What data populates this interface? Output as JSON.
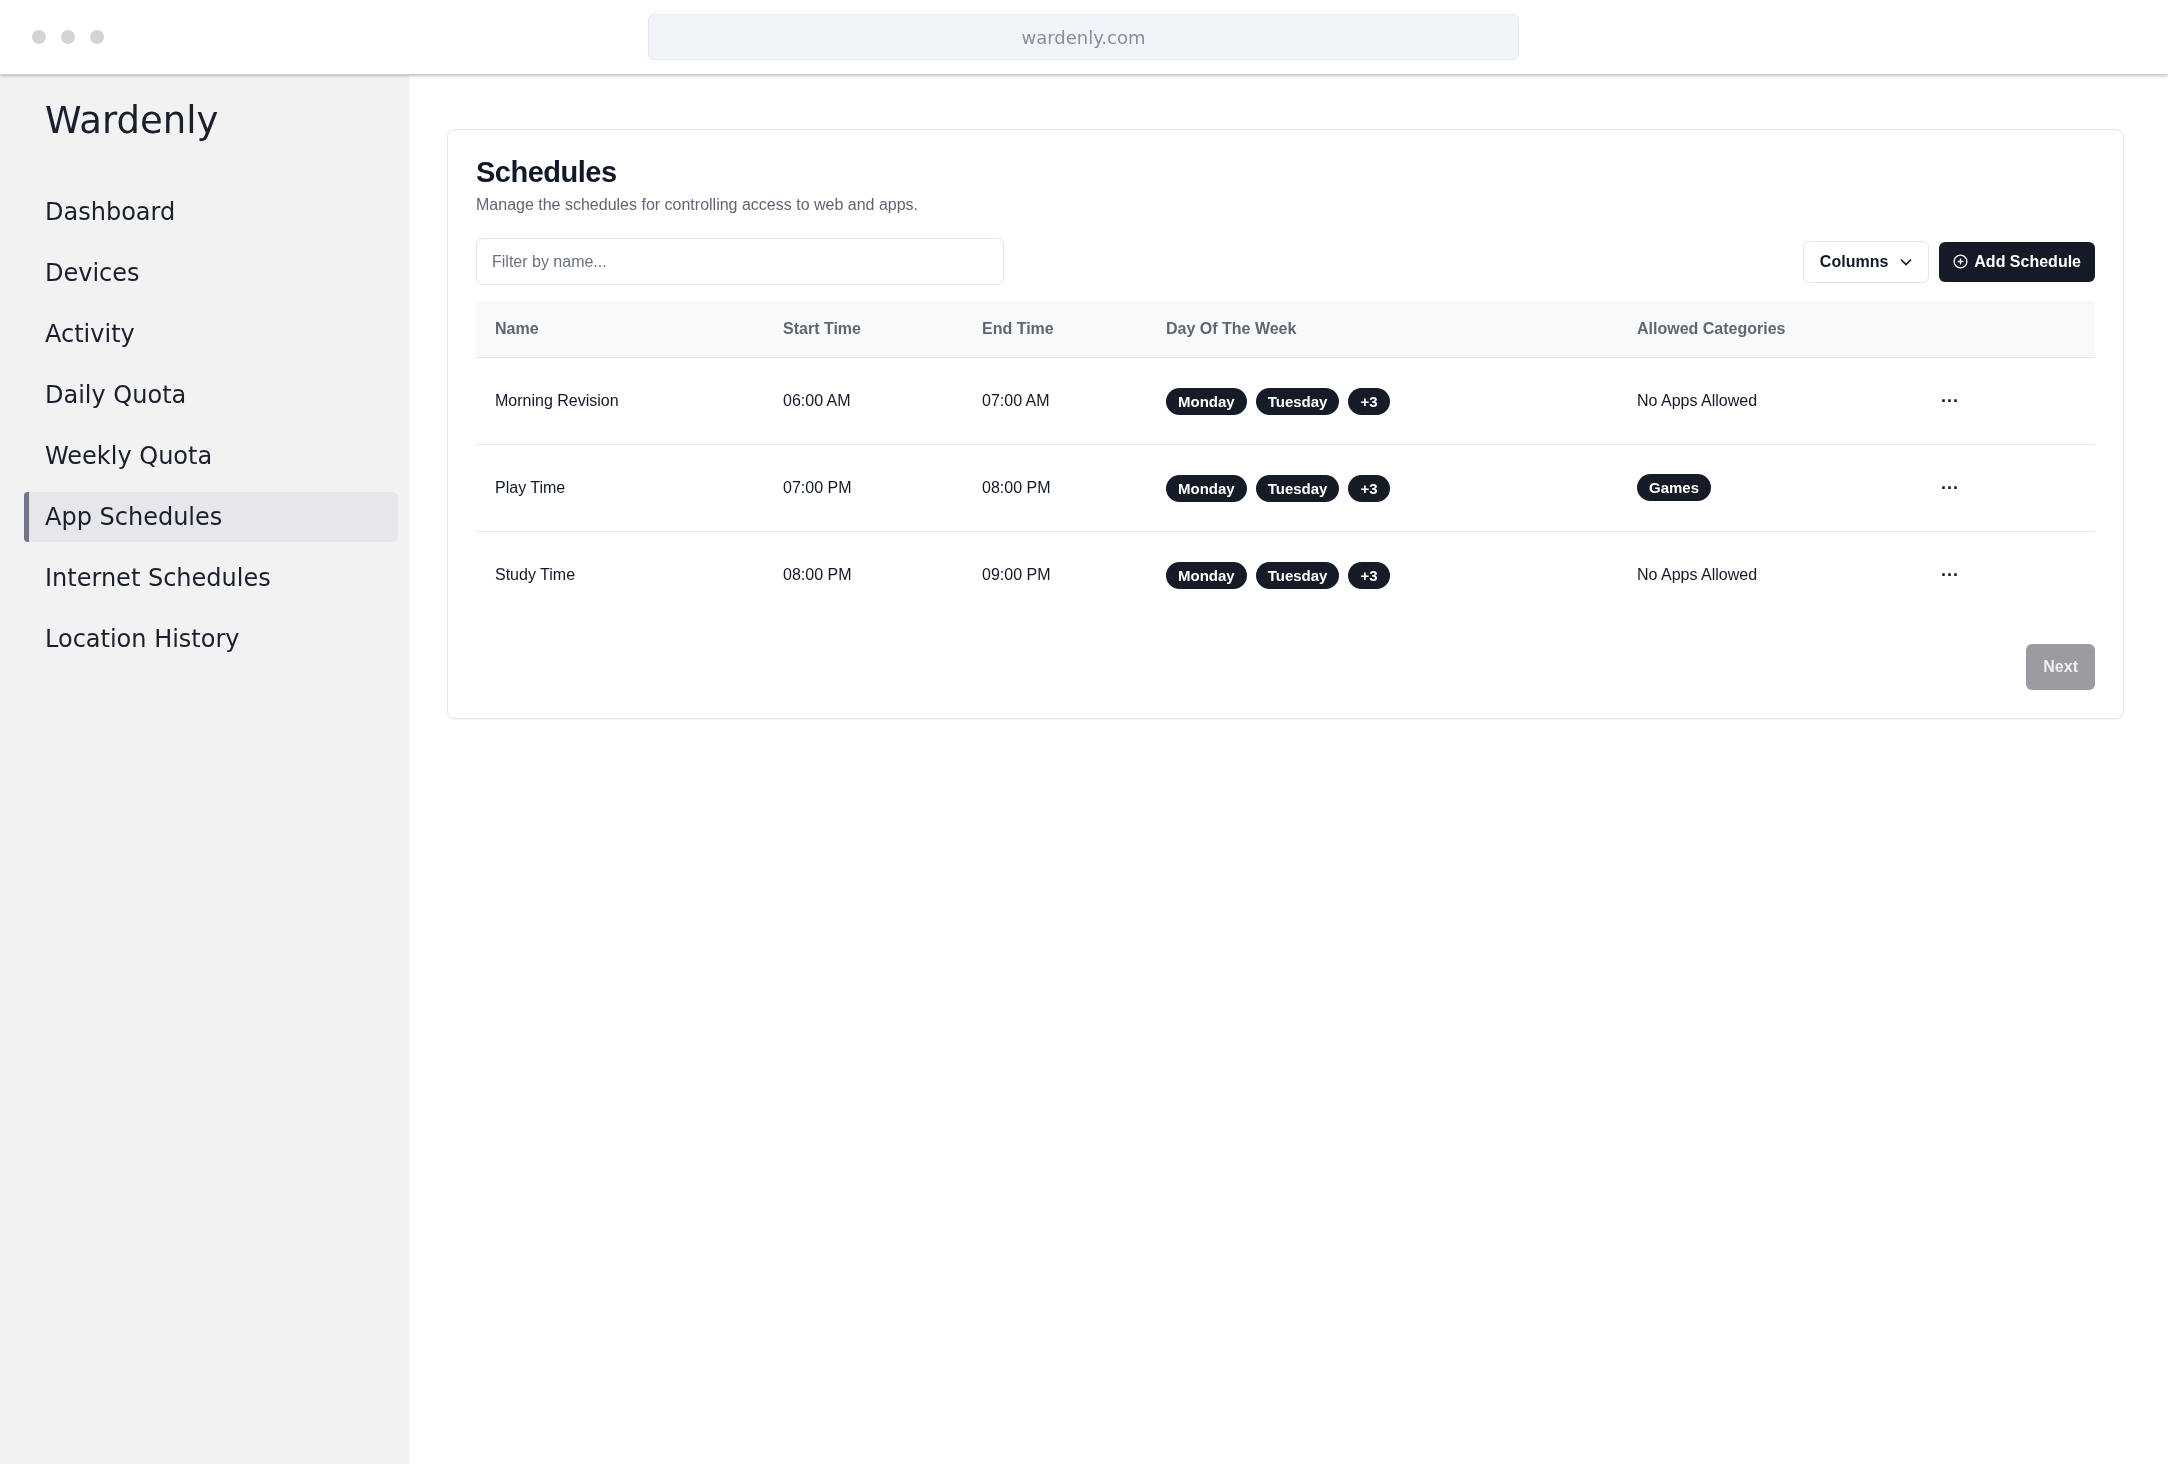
{
  "browser": {
    "url": "wardenly.com"
  },
  "sidebar": {
    "logo": "Wardenly",
    "items": [
      {
        "label": "Dashboard",
        "selected": false
      },
      {
        "label": "Devices",
        "selected": false
      },
      {
        "label": "Activity",
        "selected": false
      },
      {
        "label": "Daily Quota",
        "selected": false
      },
      {
        "label": "Weekly Quota",
        "selected": false
      },
      {
        "label": "App Schedules",
        "selected": true
      },
      {
        "label": "Internet Schedules",
        "selected": false
      },
      {
        "label": "Location History",
        "selected": false
      }
    ]
  },
  "page": {
    "title": "Schedules",
    "subtitle": "Manage the schedules for controlling access to web and apps.",
    "filter": {
      "placeholder": "Filter by name..."
    },
    "columns_button": "Columns",
    "add_button": "Add Schedule"
  },
  "table": {
    "columns": [
      "Name",
      "Start Time",
      "End Time",
      "Day Of The Week",
      "Allowed Categories"
    ],
    "rows": [
      {
        "name": "Morning Revision",
        "start": "06:00 AM",
        "end": "07:00 AM",
        "days": [
          "Monday",
          "Tuesday",
          "+3"
        ],
        "allowed": {
          "kind": "text",
          "value": "No Apps Allowed"
        },
        "actions": "···"
      },
      {
        "name": "Play Time",
        "start": "07:00 PM",
        "end": "08:00 PM",
        "days": [
          "Monday",
          "Tuesday",
          "+3"
        ],
        "allowed": {
          "kind": "badge",
          "value": "Games"
        },
        "actions": "···"
      },
      {
        "name": "Study Time",
        "start": "08:00 PM",
        "end": "09:00 PM",
        "days": [
          "Monday",
          "Tuesday",
          "+3"
        ],
        "allowed": {
          "kind": "text",
          "value": "No Apps Allowed"
        },
        "actions": "···"
      }
    ]
  },
  "pagination": {
    "next": {
      "label": "Next",
      "disabled": true
    }
  }
}
